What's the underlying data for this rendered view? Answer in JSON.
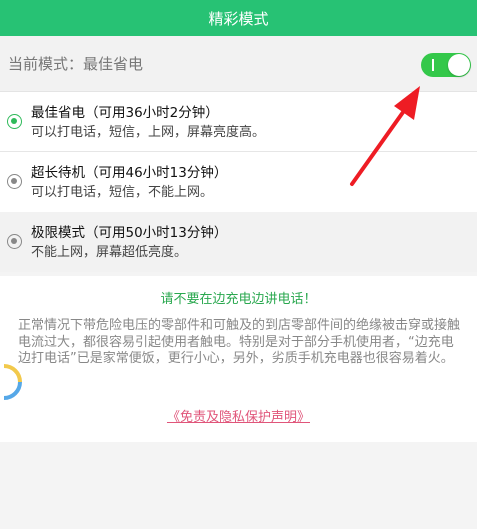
{
  "header": {
    "title": "精彩模式"
  },
  "current_mode": {
    "label": "当前模式：最佳省电",
    "toggle_on": true
  },
  "options": [
    {
      "title": "最佳省电（可用36小时2分钟）",
      "desc": "可以打电话，短信，上网，屏幕亮度高。",
      "selected": true
    },
    {
      "title": "超长待机（可用46小时13分钟）",
      "desc": "可以打电话，短信，不能上网。",
      "selected": false
    },
    {
      "title": "极限模式（可用50小时13分钟）",
      "desc": "不能上网，屏幕超低亮度。",
      "selected": false
    }
  ],
  "notice": {
    "warning": "请不要在边充电边讲电话！",
    "body": "正常情况下带危险电压的零部件和可触及的到店零部件间的绝缘被击穿或接触电流过大，都很容易引起使用者触电。特别是对于部分手机使用者，“边充电边打电话”已是家常便饭，更行小心，另外，劣质手机充电器也很容易着火。",
    "link": "《免责及隐私保护声明》"
  },
  "colors": {
    "accent": "#27c274",
    "toggle": "#34c84a",
    "link": "#e0557a",
    "annotation": "#ee1c24"
  }
}
